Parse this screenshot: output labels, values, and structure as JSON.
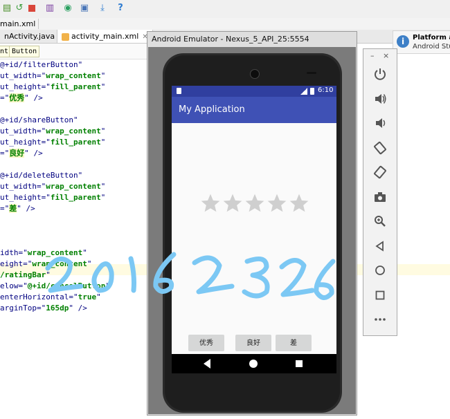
{
  "toolbar": {
    "icons": [
      "save-icon",
      "sync-icon",
      "stop-icon",
      "structure-icon",
      "refresh-icon",
      "sdk-manager-icon",
      "download-icon",
      "help-icon"
    ],
    "help_label": "?"
  },
  "breadcrumb": {
    "file": "main.xml"
  },
  "tabs": [
    {
      "label": "nActivity.java",
      "active": false
    },
    {
      "label": "activity_main.xml",
      "active": true
    }
  ],
  "path_tags": [
    "nt",
    "Button"
  ],
  "editor": {
    "lines": [
      {
        "text": "@+id/filterButton\"",
        "attr": ""
      },
      {
        "text": "ut_width=\"",
        "val": "wrap_content",
        "end": "\""
      },
      {
        "text": "ut_height=\"",
        "val": "fill_parent",
        "end": "\""
      },
      {
        "text": "=\"",
        "hl": "优秀",
        "end": "\" />"
      },
      {
        "text": "",
        "val": "",
        "end": ""
      },
      {
        "text": "@+id/shareButton\"",
        "attr": ""
      },
      {
        "text": "ut_width=\"",
        "val": "wrap_content",
        "end": "\""
      },
      {
        "text": "ut_height=\"",
        "val": "fill_parent",
        "end": "\""
      },
      {
        "text": "=\"",
        "hl": "良好",
        "end": "\" />"
      },
      {
        "text": "",
        "val": "",
        "end": ""
      },
      {
        "text": "@+id/deleteButton\"",
        "attr": ""
      },
      {
        "text": "ut_width=\"",
        "val": "wrap_content",
        "end": "\""
      },
      {
        "text": "ut_height=\"",
        "val": "fill_parent",
        "end": "\""
      },
      {
        "text": "=\"",
        "hl": "差",
        "end": "\" />"
      },
      {
        "text": "",
        "val": "",
        "end": ""
      },
      {
        "text": "",
        "val": "",
        "end": ""
      },
      {
        "text": "",
        "val": "",
        "end": ""
      },
      {
        "text": "idth=\"",
        "val": "wrap_content",
        "end": "\""
      },
      {
        "text": "eight=\"",
        "val": "wrap_content",
        "end": "\""
      },
      {
        "text": "",
        "val": "/ratingBar",
        "end": "\""
      },
      {
        "text": "elow=\"",
        "val": "@+id/cancelButton",
        "end": "\""
      },
      {
        "text": "enterHorizontal=\"",
        "val": "true",
        "end": "\""
      },
      {
        "text": "arginTop=\"",
        "val": "165dp",
        "end": "\" />"
      }
    ]
  },
  "notification": {
    "title": "Platform an",
    "subtitle": "Android Studi"
  },
  "emulator": {
    "window_title": "Android Emulator - Nexus_5_API_25:5554",
    "status_time": "6:10",
    "app_title": "My Application",
    "rating": {
      "stars": 5,
      "value": 0
    },
    "buttons": [
      "优秀",
      "良好",
      "差"
    ],
    "colors": {
      "status_bar": "#303f9f",
      "app_bar": "#3f51b5",
      "star_empty": "#cfcfcf"
    }
  },
  "side_panel": {
    "minimize_label": "–",
    "close_label": "×",
    "icons": [
      "power-icon",
      "volume-up-icon",
      "volume-down-icon",
      "rotate-left-icon",
      "rotate-right-icon",
      "camera-icon",
      "zoom-icon",
      "back-icon",
      "home-icon",
      "overview-icon",
      "more-icon"
    ]
  },
  "handwriting": {
    "text": "20162326"
  }
}
